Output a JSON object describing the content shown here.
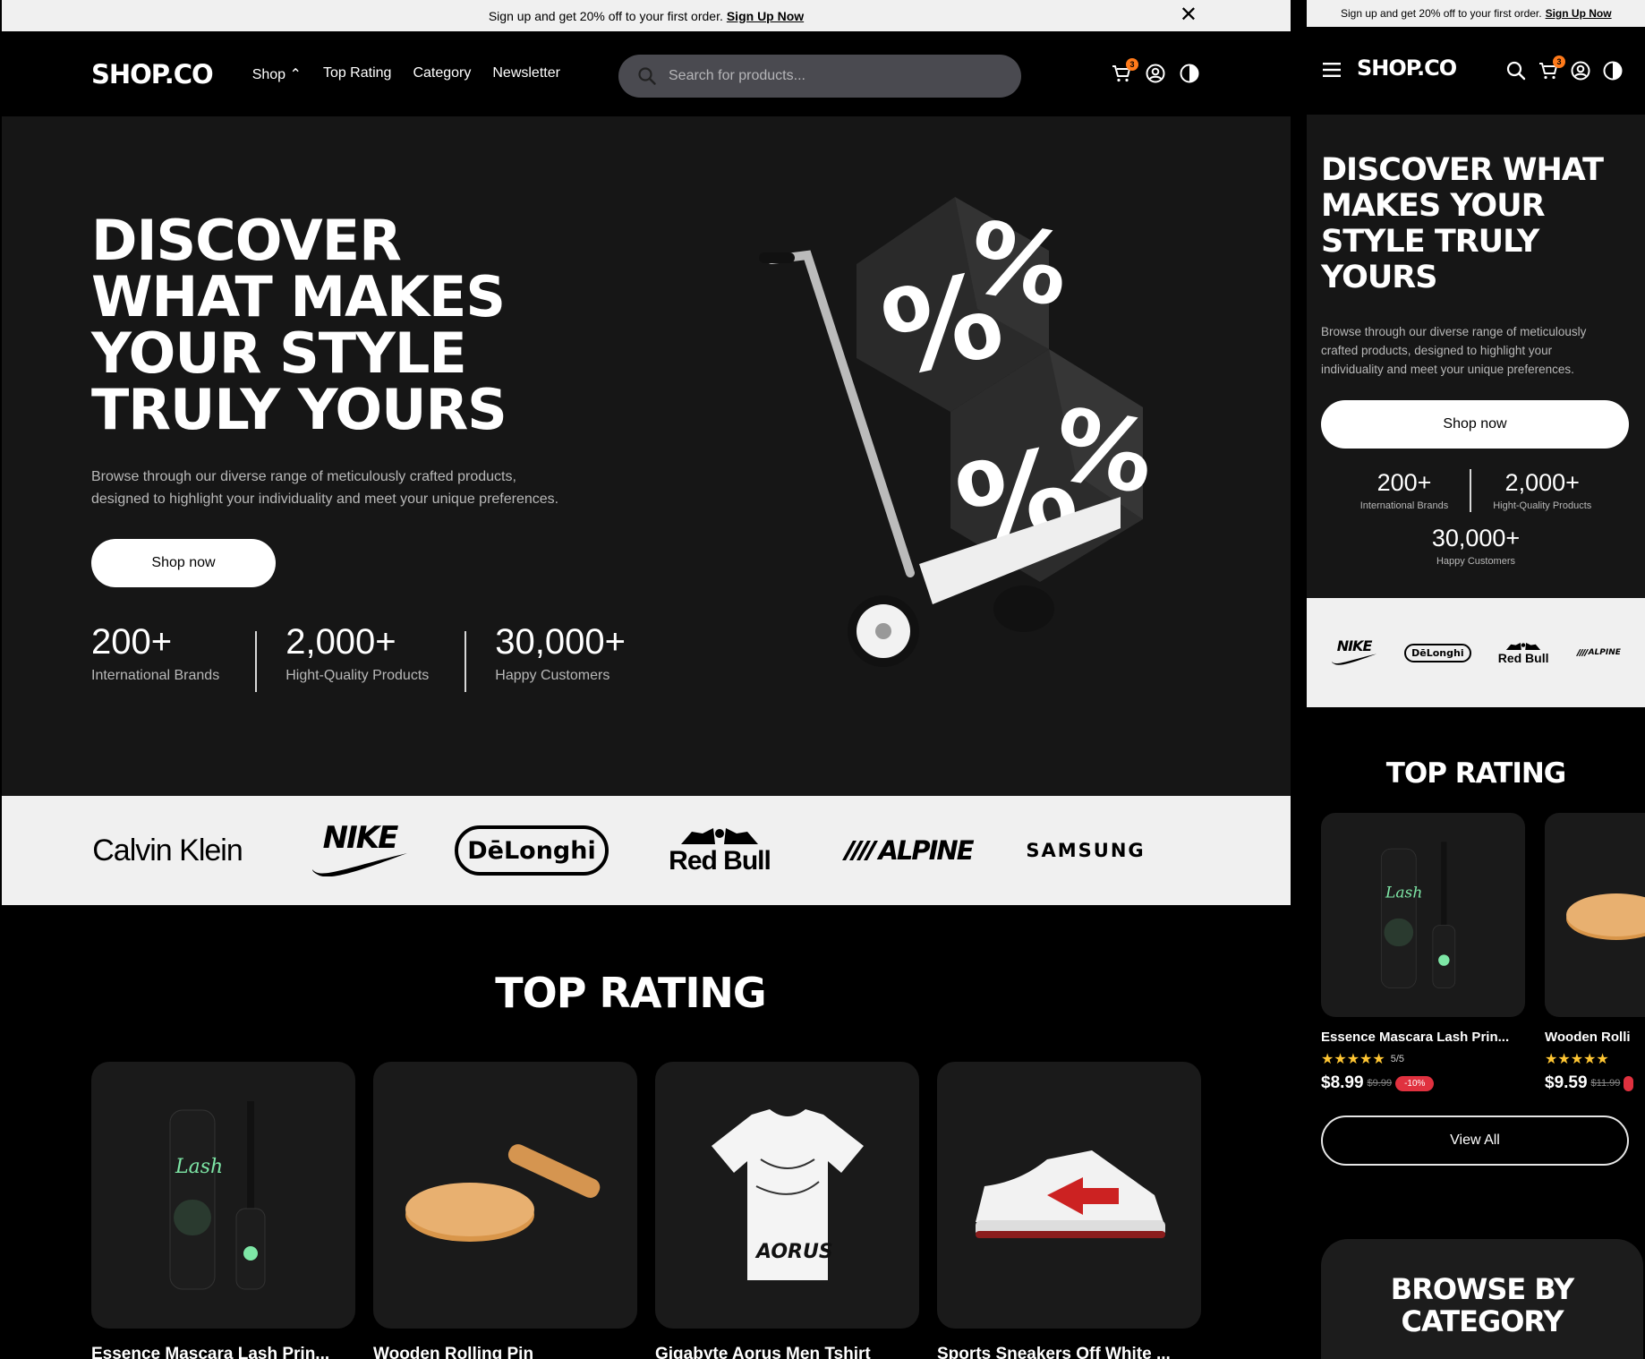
{
  "promo": {
    "text": "Sign up and get 20% off to your first order.",
    "link": "Sign Up Now"
  },
  "nav": {
    "logo": "SHOP.CO",
    "menu": [
      "Shop",
      "Top Rating",
      "Category",
      "Newsletter"
    ],
    "search_placeholder": "Search for products...",
    "cart_count": "3"
  },
  "hero": {
    "title": "DISCOVER WHAT MAKES YOUR STYLE TRULY YOURS",
    "subtitle": "Browse through our diverse range of meticulously crafted products, designed to highlight your individuality and meet your unique preferences.",
    "cta": "Shop now",
    "stats": [
      {
        "value": "200+",
        "label": "International Brands"
      },
      {
        "value": "2,000+",
        "label": "Hight-Quality Products"
      },
      {
        "value": "30,000+",
        "label": "Happy Customers"
      }
    ]
  },
  "brands": [
    "Calvin Klein",
    "NIKE",
    "DēLonghi",
    "Red Bull",
    "ALPINE",
    "SAMSUNG"
  ],
  "top_rating": {
    "title": "TOP RATING",
    "products": [
      {
        "name": "Essence Mascara Lash Prin...",
        "rating": "5/5",
        "price": "$8.99",
        "old_price": "$9.99",
        "discount": "-10%"
      },
      {
        "name": "Wooden Rolling Pin",
        "price": "$9.59",
        "old_price": "$11.99"
      },
      {
        "name": "Gigabyte Aorus Men Tshirt"
      },
      {
        "name": "Sports Sneakers Off White ..."
      }
    ],
    "view_all": "View All"
  },
  "mobile": {
    "wooden_name": "Wooden Rolli",
    "browse_title": "BROWSE BY CATEGORY"
  },
  "colors": {
    "accent_badge": "#ff7a1a",
    "discount_red": "#e0313f",
    "star": "#ffc633",
    "hero_bg": "#161616",
    "brands_bg": "#f0f0f0"
  }
}
